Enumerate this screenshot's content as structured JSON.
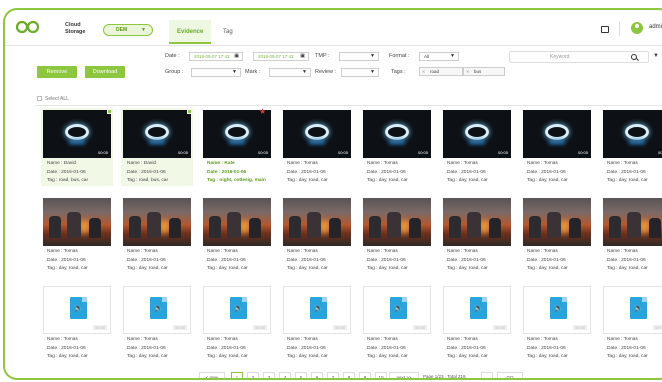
{
  "header": {
    "brand_line1": "Cloud",
    "brand_line2": "Storage",
    "domain": "DEM",
    "tabs": [
      "Evidence",
      "Tag"
    ],
    "user": "admin"
  },
  "filters": {
    "date_label": "Date",
    "date_from": "2016-05-07 17:43",
    "date_to": "2016-05-07 17:43",
    "tmp_label": "TMP",
    "format_label": "Format",
    "format_value": "All",
    "keyword_placeholder": "Keyword",
    "group_label": "Group",
    "mark_label": "Mark",
    "review_label": "Review",
    "tags_label": "Tags",
    "chips": [
      "road",
      "bus"
    ],
    "remove_button": "Remove",
    "download_button": "Download",
    "select_all": "Select ALL"
  },
  "rows": [
    {
      "kind": "cam",
      "cards": [
        {
          "name": "Name : David",
          "date": "Date  :  2016-01-06",
          "tag": "Tag   :  road, bus, car",
          "dur": "00:05",
          "selected": true
        },
        {
          "name": "Name : David",
          "date": "Date  :  2016-01-06",
          "tag": "Tag   :  road, bus, car",
          "dur": "00:05",
          "selected": true
        },
        {
          "name": "Name  :  Kate",
          "date": "Date  :  2016-01-06",
          "tag": "Tag   :  night, cotlesig, main",
          "dur": "00:05",
          "starred": true,
          "green": true
        },
        {
          "name": "Name : Tomas",
          "date": "Date  :  2016-01-06",
          "tag": "Tag  :  day, road, car",
          "dur": "00:05"
        },
        {
          "name": "Name : Tomas",
          "date": "Date  :  2016-01-06",
          "tag": "Tag  :  day, road, car",
          "dur": "00:05"
        },
        {
          "name": "Name : Tomas",
          "date": "Date  :  2016-01-06",
          "tag": "Tag  :  day, road, car",
          "dur": "00:05"
        },
        {
          "name": "Name : Tomas",
          "date": "Date  :  2016-01-06",
          "tag": "Tag  :  day, road, car",
          "dur": "00:05"
        },
        {
          "name": "Name : Tomas",
          "date": "Date  :  2016-01-06",
          "tag": "Tag  :  day, road, car",
          "dur": "00:05"
        }
      ]
    },
    {
      "kind": "fire",
      "cards": [
        {
          "name": "Name : Tomas",
          "date": "Date  :  2016-01-06",
          "tag": "Tag  :  day, road, car"
        },
        {
          "name": "Name : Tomas",
          "date": "Date  :  2016-01-06",
          "tag": "Tag  :  day, road, car"
        },
        {
          "name": "Name : Tomas",
          "date": "Date  :  2016-01-06",
          "tag": "Tag  :  day, road, car"
        },
        {
          "name": "Name : Tomas",
          "date": "Date  :  2016-01-06",
          "tag": "Tag  :  day, road, car"
        },
        {
          "name": "Name : Tomas",
          "date": "Date  :  2016-01-06",
          "tag": "Tag  :  day, road, car"
        },
        {
          "name": "Name : Tomas",
          "date": "Date  :  2016-01-06",
          "tag": "Tag  :  day, road, car"
        },
        {
          "name": "Name : Tomas",
          "date": "Date  :  2016-01-06",
          "tag": "Tag  :  day, road, car"
        },
        {
          "name": "Name : Tomas",
          "date": "Date  :  2016-01-06",
          "tag": "Tag  :  day, road, car"
        }
      ]
    },
    {
      "kind": "audio",
      "cards": [
        {
          "name": "Name : Tomas",
          "date": "Date  :  2016-01-06",
          "tag": "Tag  :  day, road, car",
          "dur": "00:05"
        },
        {
          "name": "Name : Tomas",
          "date": "Date  :  2016-01-06",
          "tag": "Tag  :  day, road, car",
          "dur": "00:05"
        },
        {
          "name": "Name : Tomas",
          "date": "Date  :  2016-01-06",
          "tag": "Tag  :  day, road, car",
          "dur": "00:05"
        },
        {
          "name": "Name : Tomas",
          "date": "Date  :  2016-01-06",
          "tag": "Tag  :  day, road, car",
          "dur": "00:05"
        },
        {
          "name": "Name : Tomas",
          "date": "Date  :  2016-01-06",
          "tag": "Tag  :  day, road, car",
          "dur": "00:05"
        },
        {
          "name": "Name : Tomas",
          "date": "Date  :  2016-01-06",
          "tag": "Tag  :  day, road, car",
          "dur": "00:05"
        },
        {
          "name": "Name : Tomas",
          "date": "Date  :  2016-01-06",
          "tag": "Tag  :  day, road, car",
          "dur": "00:05"
        },
        {
          "name": "Name : Tomas",
          "date": "Date  :  2016-01-06",
          "tag": "Tag  :  day, road, car",
          "dur": "00:05"
        }
      ]
    }
  ],
  "pagination": {
    "prev": "< prev",
    "pages": [
      "1",
      "2",
      "3",
      "4",
      "5",
      "6",
      "7",
      "8",
      "9",
      "10"
    ],
    "next": "next >>",
    "info": "Page 1/23 , Total 219",
    "go": "GO"
  }
}
